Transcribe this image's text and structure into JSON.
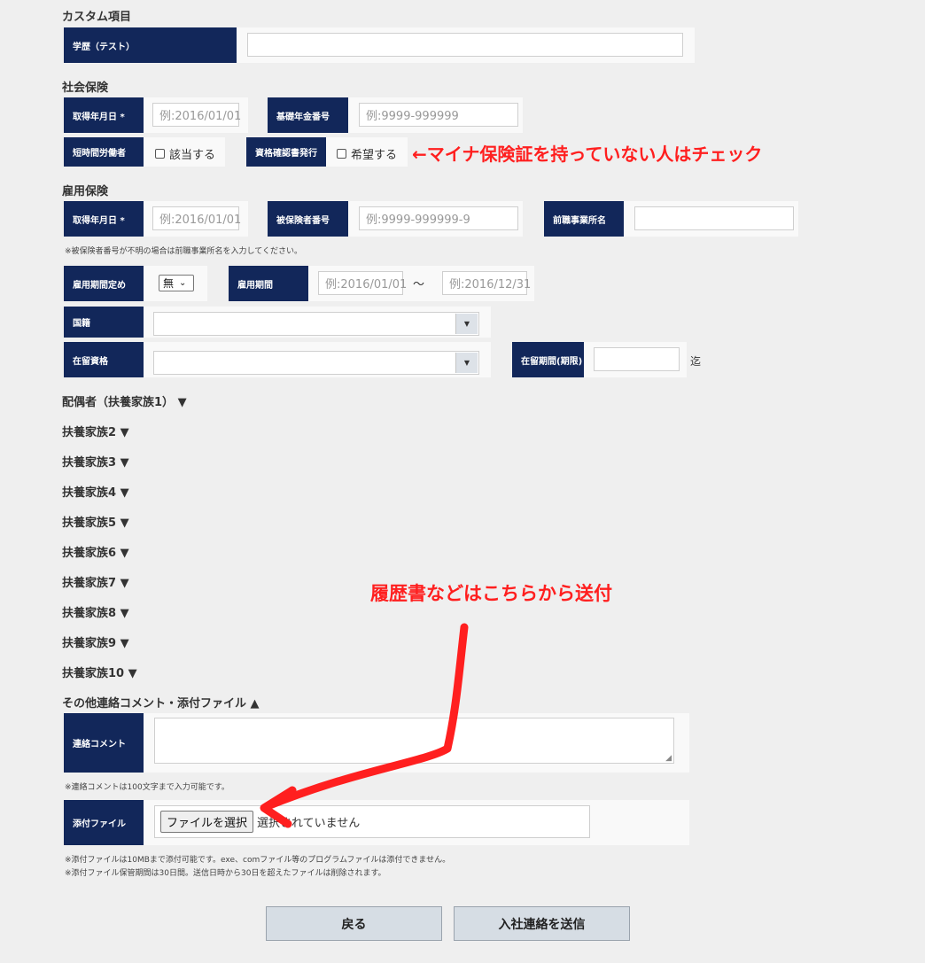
{
  "custom": {
    "title": "カスタム項目",
    "education_label": "学歴（テスト）",
    "education_value": ""
  },
  "social": {
    "title": "社会保険",
    "acq_date_label": "取得年月日 *",
    "acq_date_placeholder": "例:2016/01/01",
    "pension_label": "基礎年金番号",
    "pension_placeholder": "例:9999-999999",
    "short_time_label": "短時間労働者",
    "short_time_option": "該当する",
    "cert_label": "資格確認書発行",
    "cert_option": "希望する"
  },
  "employment": {
    "title": "雇用保険",
    "acq_date_label": "取得年月日 *",
    "acq_date_placeholder": "例:2016/01/01",
    "insured_no_label": "被保険者番号",
    "insured_no_placeholder": "例:9999-999999-9",
    "prev_employer_label": "前職事業所名",
    "note": "※被保険者番号が不明の場合は前職事業所名を入力してください。",
    "period_fixed_label": "雇用期間定め",
    "period_fixed_value": "無",
    "period_label": "雇用期間",
    "period_from_placeholder": "例:2016/01/01",
    "period_sep": "～",
    "period_to_placeholder": "例:2016/12/31",
    "nationality_label": "国籍",
    "residence_status_label": "在留資格",
    "residence_period_label": "在留期間(期限)",
    "residence_until": "迄"
  },
  "dependents": [
    "配偶者（扶養家族1） ▼",
    "扶養家族2 ▼",
    "扶養家族3 ▼",
    "扶養家族4 ▼",
    "扶養家族5 ▼",
    "扶養家族6 ▼",
    "扶養家族7 ▼",
    "扶養家族8 ▼",
    "扶養家族9 ▼",
    "扶養家族10 ▼"
  ],
  "other": {
    "title": "その他連絡コメント・添付ファイル ▲",
    "comment_label": "連絡コメント",
    "comment_note": "※連絡コメントは100文字まで入力可能です。",
    "file_label": "添付ファイル",
    "file_button": "ファイルを選択",
    "file_status": "選択されていません",
    "file_note1": "※添付ファイルは10MBまで添付可能です。exe、comファイル等のプログラムファイルは添付できません。",
    "file_note2": "※添付ファイル保管期間は30日間。送信日時から30日を超えたファイルは削除されます。"
  },
  "buttons": {
    "back": "戻る",
    "submit": "入社連絡を送信"
  },
  "annotations": {
    "checkbox_note": "←マイナ保険証を持っていない人はチェック",
    "file_note": "履歴書などはこちらから送付"
  },
  "colors": {
    "label_bg": "#12275a",
    "annotation": "#ff1f1f"
  }
}
